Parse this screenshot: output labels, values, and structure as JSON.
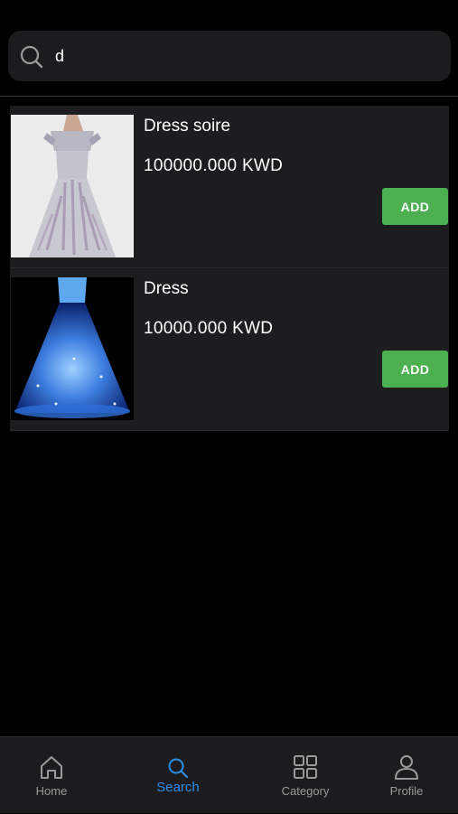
{
  "search": {
    "value": "d",
    "placeholder": ""
  },
  "results": [
    {
      "title": "Dress soire",
      "price": "100000.000 KWD",
      "add_label": "ADD"
    },
    {
      "title": "Dress",
      "price": "10000.000 KWD",
      "add_label": "ADD"
    }
  ],
  "tabs": [
    {
      "label": "Home",
      "icon": "home-icon"
    },
    {
      "label": "Search",
      "icon": "search-icon",
      "active": true
    },
    {
      "label": "Category",
      "icon": "grid-icon"
    },
    {
      "label": "Profile",
      "icon": "user-icon"
    }
  ],
  "colors": {
    "accent": "#2f8de4",
    "add_button": "#4caf50",
    "card_bg": "#1c1d1f"
  }
}
